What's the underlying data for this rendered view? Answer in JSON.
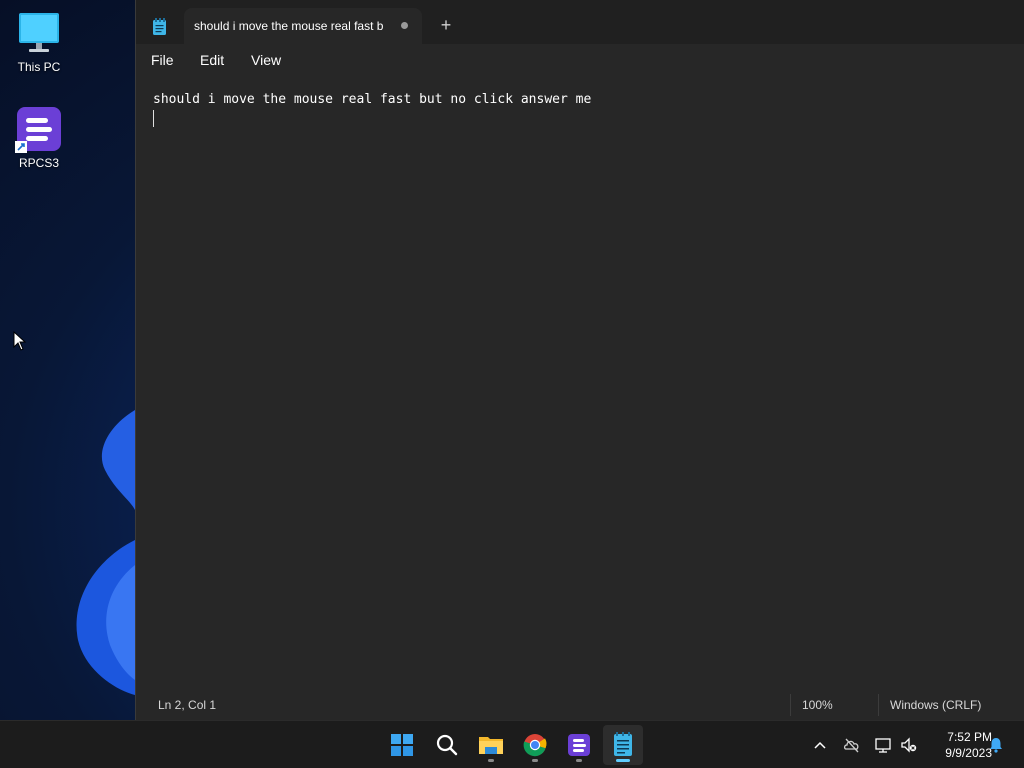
{
  "desktop": {
    "icons": [
      {
        "label": "This PC",
        "icon": "monitor-icon"
      },
      {
        "label": "RPCS3",
        "icon": "rpcs3-icon"
      }
    ]
  },
  "notepad": {
    "tab": {
      "title": "should i move the mouse real fast but no click answer me",
      "unsaved": true
    },
    "menu": {
      "file": "File",
      "edit": "Edit",
      "view": "View"
    },
    "editor": {
      "lines": [
        "should i move the mouse real fast but no click answer me",
        ""
      ]
    },
    "status": {
      "position": "Ln 2, Col 1",
      "zoom": "100%",
      "line_ending": "Windows (CRLF)"
    }
  },
  "taskbar": {
    "apps": [
      "start-icon",
      "search-icon",
      "file-explorer-icon",
      "chrome-icon",
      "rpcs3-icon",
      "notepad-icon"
    ],
    "clock": {
      "time": "7:52 PM",
      "date": "9/9/2023"
    }
  },
  "colors": {
    "window_bg": "#272727",
    "tabbar_bg": "#202020",
    "taskbar_bg": "#1c1c1c",
    "accent": "#60cdff"
  }
}
